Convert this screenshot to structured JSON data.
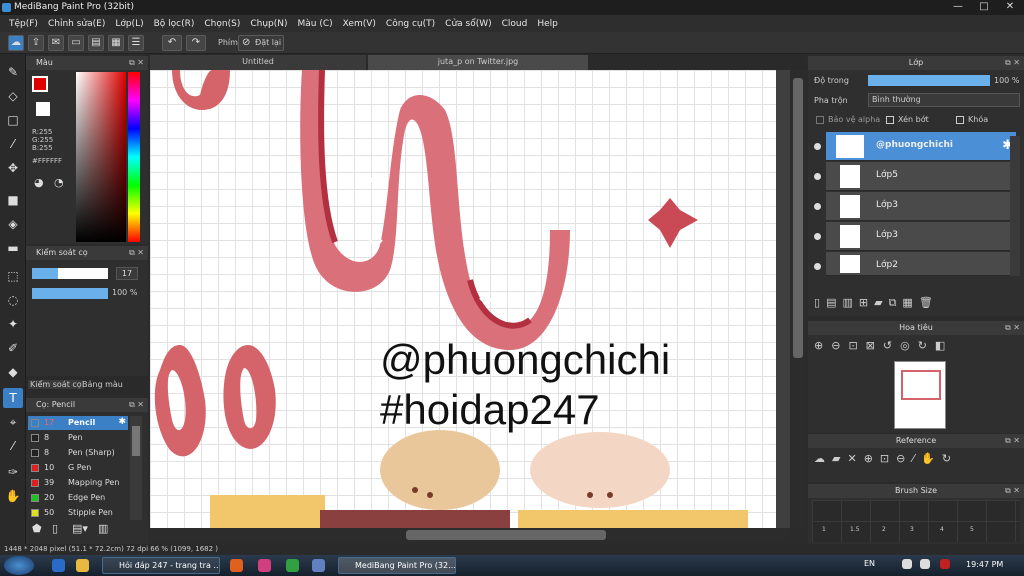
{
  "titlebar": {
    "title": "MediBang Paint Pro (32bit)"
  },
  "menu": [
    "Tệp(F)",
    "Chỉnh sửa(E)",
    "Lớp(L)",
    "Bộ lọc(R)",
    "Chọn(S)",
    "Chụp(N)",
    "Màu (C)",
    "Xem(V)",
    "Công cụ(T)",
    "Cửa sổ(W)",
    "Cloud",
    "Help"
  ],
  "toolbar": {
    "label_phim": "Phím",
    "reset_label": "Đặt lại"
  },
  "color_panel": {
    "title": "Màu",
    "r": "R:255",
    "g": "G:255",
    "b": "B:255",
    "hex": "#FFFFFF"
  },
  "control_panel": {
    "title": "Kiểm soát cọ",
    "size_value": "17",
    "opacity_value": "100 %"
  },
  "left_tabs": {
    "tab1": "Kiểm soát cọ",
    "tab2": "Bảng màu"
  },
  "brush_list": {
    "title": "Cọ: Pencil",
    "items": [
      {
        "size": "17",
        "name": "Pencil",
        "color": "#3b7fc4"
      },
      {
        "size": "8",
        "name": "Pen",
        "color": "#222222"
      },
      {
        "size": "8",
        "name": "Pen (Sharp)",
        "color": "#222222"
      },
      {
        "size": "10",
        "name": "G Pen",
        "color": "#e02020"
      },
      {
        "size": "39",
        "name": "Mapping Pen",
        "color": "#e02020"
      },
      {
        "size": "20",
        "name": "Edge Pen",
        "color": "#20c020"
      },
      {
        "size": "50",
        "name": "Stipple Pen",
        "color": "#e0e020"
      }
    ]
  },
  "documents": {
    "tab1": "Untitled",
    "tab2": "juta_p on Twitter.jpg"
  },
  "canvas": {
    "text1": "@phuongchichi",
    "text2": "#hoidap247"
  },
  "layer_panel": {
    "title": "Lớp",
    "opacity_label": "Độ trong",
    "opacity_value": "100 %",
    "blend_label": "Pha trộn",
    "blend_value": "Bình thường",
    "protect_alpha": "Bảo vệ alpha",
    "clipping": "Xén bớt",
    "lock": "Khóa",
    "layers": [
      "@phuongchichi",
      "Lớp5",
      "Lớp3",
      "Lớp3",
      "Lớp2"
    ]
  },
  "navigator": {
    "title": "Hoa tiêu"
  },
  "reference": {
    "title": "Reference"
  },
  "brush_size": {
    "title": "Brush Size",
    "values": [
      "1",
      "1.5",
      "2",
      "3",
      "4",
      "5"
    ]
  },
  "status": {
    "text": "1448 * 2048 pixel  (51.1 * 72.2cm)  72 dpi  66 %  (1099, 1682 )"
  },
  "taskbar": {
    "task1": "Hỏi đáp 247 - trang tra ...",
    "task2": "MediBang Paint Pro (32...",
    "lang": "EN",
    "time": "19:47 PM"
  },
  "colors": {
    "accent": "#3b7fc4",
    "selected_layer": "#4b8fd6",
    "pink": "#d4636a"
  }
}
